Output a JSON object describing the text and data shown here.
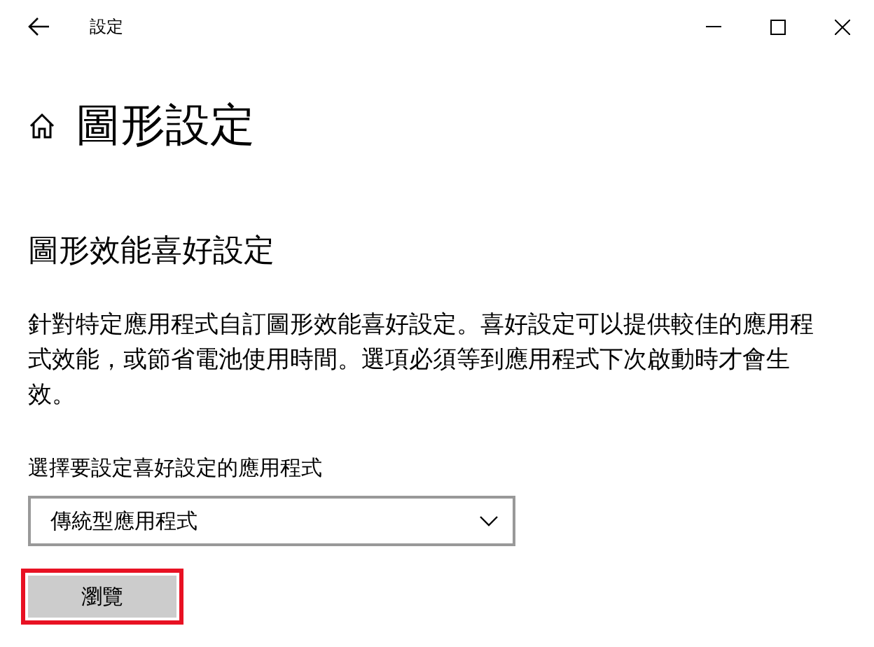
{
  "window": {
    "title": "設定"
  },
  "page": {
    "title": "圖形設定"
  },
  "section": {
    "title": "圖形效能喜好設定",
    "description": "針對特定應用程式自訂圖形效能喜好設定。喜好設定可以提供較佳的應用程式效能，或節省電池使用時間。選項必須等到應用程式下次啟動時才會生效。"
  },
  "app_picker": {
    "label": "選擇要設定喜好設定的應用程式",
    "value": "傳統型應用程式"
  },
  "browse_button": {
    "label": "瀏覽",
    "highlighted": true
  }
}
